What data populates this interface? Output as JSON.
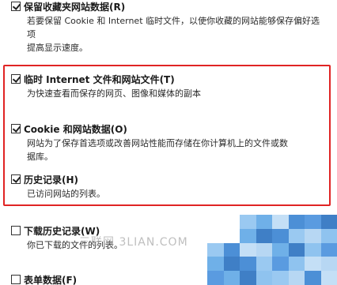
{
  "options": [
    {
      "label": "保留收藏夹网站数据(R)",
      "description_lines": [
        "若要保留 Cookie 和 Internet 临时文件，以使你收藏的网站能够保存偏好选项",
        "提高显示速度。"
      ],
      "checked": true
    },
    {
      "label": "临时 Internet 文件和网站文件(T)",
      "description_lines": [
        "为快速查看而保存的网页、图像和媒体的副本"
      ],
      "checked": true
    },
    {
      "label": "Cookie 和网站数据(O)",
      "description_lines": [
        "网站为了保存首选项或改善网站性能而存储在你计算机上的文件或数",
        "据库。"
      ],
      "checked": true
    },
    {
      "label": "历史记录(H)",
      "description_lines": [
        "已访问网站的列表。"
      ],
      "checked": true
    },
    {
      "label": "下载历史记录(W)",
      "description_lines": [
        "你已下载的文件的列表。"
      ],
      "checked": false
    },
    {
      "label": "表单数据(F)",
      "description_lines": [],
      "checked": false
    }
  ],
  "watermark": "三联网 3LIAN.COM",
  "colors": {
    "highlight_border": "#e02424",
    "mosaic": [
      "#6fb0e8",
      "#8fc3ef",
      "#4c8fd6",
      "#b7d7f3",
      "#5a9be0",
      "#9ac9f1",
      "#3f7fc6",
      "#c4dff6"
    ]
  }
}
